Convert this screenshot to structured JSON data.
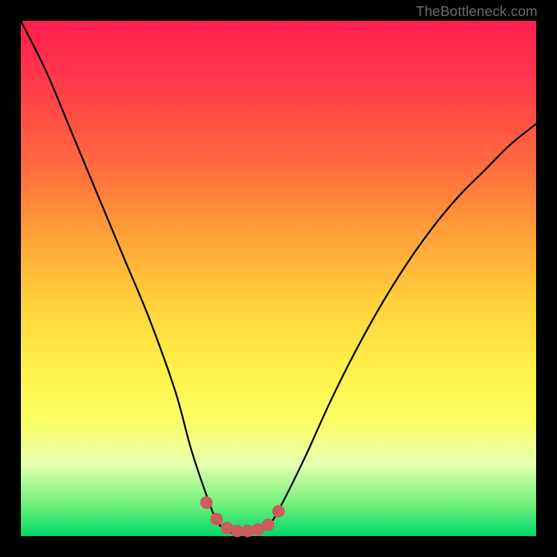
{
  "watermark": "TheBottleneck.com",
  "chart_data": {
    "type": "line",
    "title": "",
    "xlabel": "",
    "ylabel": "",
    "xlim": [
      0,
      100
    ],
    "ylim": [
      0,
      100
    ],
    "series": [
      {
        "name": "bottleneck-curve",
        "x": [
          0,
          5,
          10,
          15,
          20,
          25,
          30,
          33,
          36,
          38,
          40,
          42,
          44,
          46,
          48,
          50,
          55,
          60,
          65,
          70,
          75,
          80,
          85,
          90,
          95,
          100
        ],
        "values": [
          100,
          90,
          78,
          66,
          54,
          42,
          28,
          17,
          8,
          3,
          1,
          0.5,
          0.5,
          0.8,
          2,
          5,
          15,
          26,
          36,
          45,
          53,
          60,
          66,
          71,
          76,
          80
        ]
      },
      {
        "name": "bottom-dots",
        "x": [
          36,
          38,
          40,
          42,
          44,
          46,
          48,
          50
        ],
        "values": [
          6.5,
          3.3,
          1.6,
          1,
          1,
          1.3,
          2.2,
          4.8
        ]
      }
    ],
    "colors": {
      "curve": "#000000",
      "dots": "#cd5c5c"
    }
  }
}
